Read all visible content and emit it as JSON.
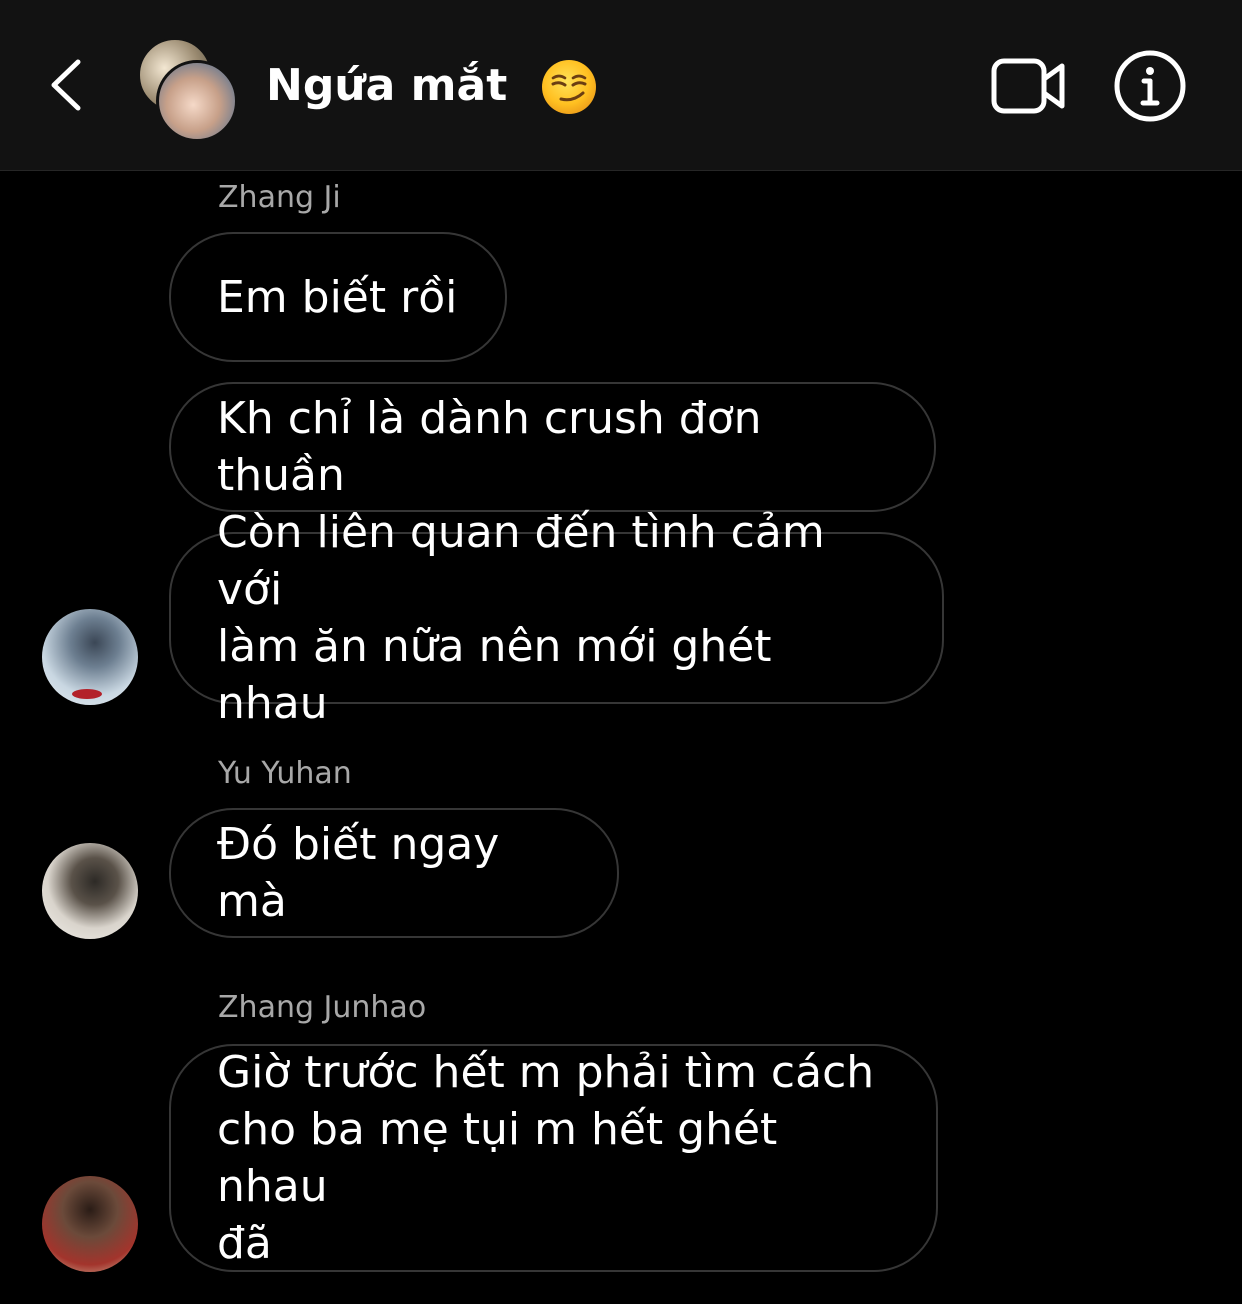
{
  "header": {
    "title": "Ngứa mắt",
    "title_emoji": "smirking-face-emoji",
    "back_icon": "chevron-left-icon",
    "video_icon": "video-camera-icon",
    "info_icon": "info-icon"
  },
  "messages": [
    {
      "sender": "Zhang Ji",
      "text": "Em biết rồi"
    },
    {
      "sender": "",
      "text": "Kh chỉ là dành crush đơn thuần"
    },
    {
      "sender": "",
      "text": "Còn liên quan đến tình cảm với\nlàm ăn nữa nên mới ghét nhau"
    },
    {
      "sender": "Yu Yuhan",
      "text": "Đó biết ngay mà"
    },
    {
      "sender": "Zhang Junhao",
      "text": "Giờ trước hết m phải tìm cách\ncho ba mẹ tụi m hết ghét nhau\nđã"
    }
  ],
  "colors": {
    "background": "#000000",
    "header_background": "#121212",
    "bubble_border": "#363636",
    "sender_text": "#a8a8a8",
    "text": "#ffffff"
  }
}
